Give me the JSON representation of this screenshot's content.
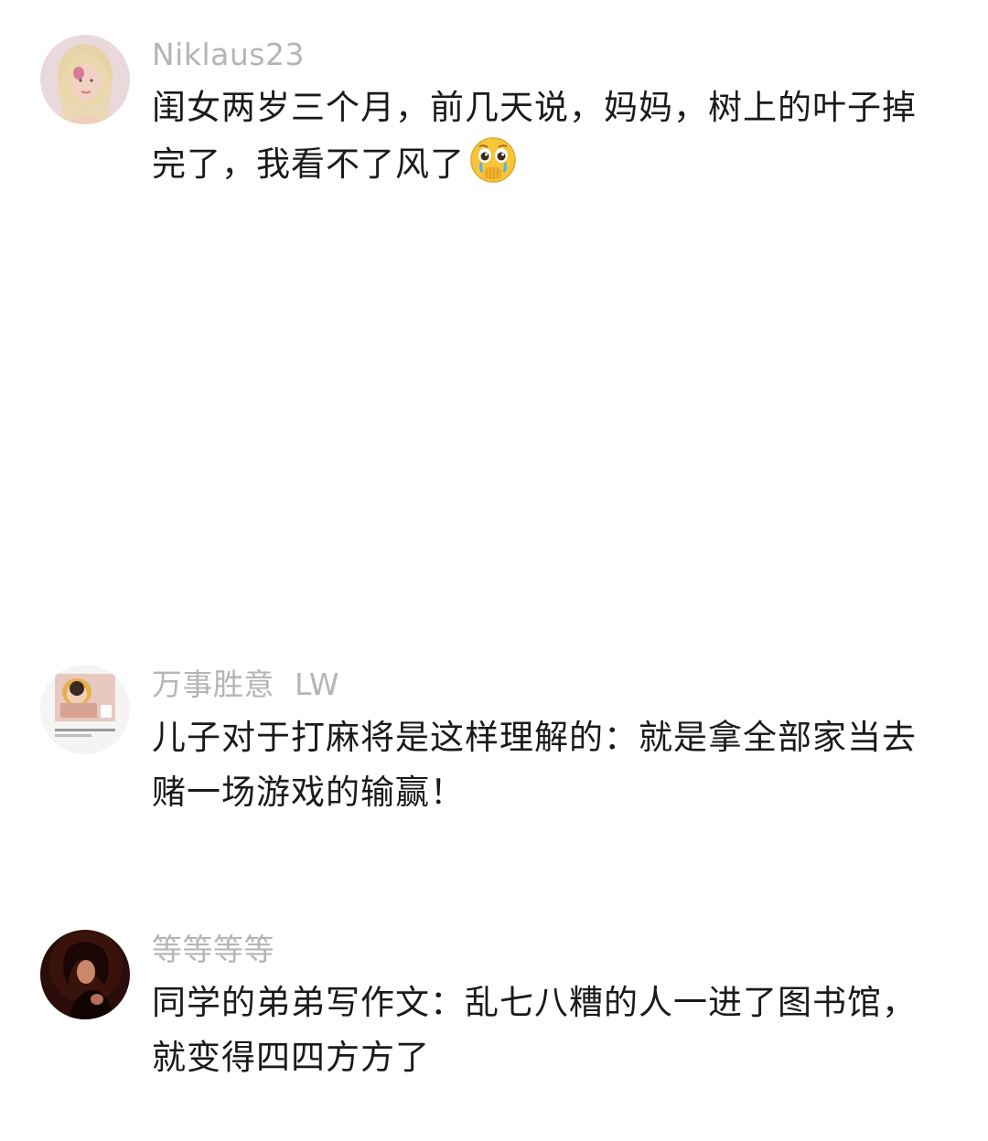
{
  "comments": [
    {
      "username": "Niklaus23",
      "text": "闺女两岁三个月，前几天说，妈妈，树上的叶子掉完了，我看不了风了",
      "emoji": "crying-face-holding-back-tears-icon",
      "avatar": "avatar-blonde-woman"
    },
    {
      "username": "万事胜意  LW",
      "text": "儿子对于打麻将是这样理解的：就是拿全部家当去赌一场游戏的输赢！",
      "avatar": "avatar-baby-photo"
    },
    {
      "username": "等等等等",
      "text": "同学的弟弟写作文：乱七八糟的人一进了图书馆，就变得四四方方了",
      "avatar": "avatar-dark-portrait"
    }
  ],
  "colors": {
    "username": "#b5b5b5",
    "text": "#1a1a1a",
    "background": "#ffffff"
  }
}
